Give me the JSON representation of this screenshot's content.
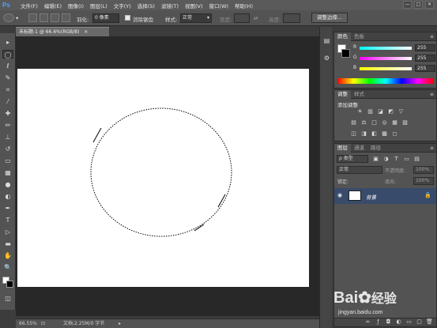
{
  "app": {
    "logo": "Ps"
  },
  "menu": [
    "文件(F)",
    "编辑(E)",
    "图像(I)",
    "图层(L)",
    "文字(Y)",
    "选择(S)",
    "滤镜(T)",
    "视图(V)",
    "窗口(W)",
    "帮助(H)"
  ],
  "window_controls": [
    "—",
    "□",
    "✕"
  ],
  "options": {
    "feather_label": "羽化:",
    "feather_value": "0 像素",
    "antialias_label": "消除锯齿",
    "style_label": "样式:",
    "style_value": "正常",
    "width_label": "宽度:",
    "height_label": "高度:",
    "refine_button": "调整边缘..."
  },
  "document": {
    "tab_title": "未标题-1 @ 66.6%(RGB/8)",
    "tab_close": "×"
  },
  "status": {
    "zoom": "66.55%",
    "doc_info": "文档:2.25M/0 字节"
  },
  "tools": [
    {
      "icon": "move-icon",
      "glyph": "▸"
    },
    {
      "icon": "ellipse-marquee-icon",
      "glyph": "◯"
    },
    {
      "icon": "lasso-icon",
      "glyph": "ℓ"
    },
    {
      "icon": "quick-select-icon",
      "glyph": "✎"
    },
    {
      "icon": "crop-icon",
      "glyph": "⌗"
    },
    {
      "icon": "eyedropper-icon",
      "glyph": "⁄"
    },
    {
      "icon": "healing-brush-icon",
      "glyph": "✚"
    },
    {
      "icon": "brush-icon",
      "glyph": "✏"
    },
    {
      "icon": "clone-stamp-icon",
      "glyph": "⊥"
    },
    {
      "icon": "history-brush-icon",
      "glyph": "↺"
    },
    {
      "icon": "eraser-icon",
      "glyph": "▭"
    },
    {
      "icon": "gradient-icon",
      "glyph": "▦"
    },
    {
      "icon": "blur-icon",
      "glyph": "●"
    },
    {
      "icon": "dodge-icon",
      "glyph": "◐"
    },
    {
      "icon": "pen-icon",
      "glyph": "✒"
    },
    {
      "icon": "type-icon",
      "glyph": "T"
    },
    {
      "icon": "path-select-icon",
      "glyph": "▷"
    },
    {
      "icon": "shape-icon",
      "glyph": "▬"
    },
    {
      "icon": "hand-icon",
      "glyph": "✋"
    },
    {
      "icon": "zoom-icon",
      "glyph": "🔍"
    }
  ],
  "color_panel": {
    "tabs": [
      "颜色",
      "色板"
    ],
    "channels": [
      {
        "label": "R",
        "value": "255",
        "color": "#e04848"
      },
      {
        "label": "G",
        "value": "255",
        "color": "#48d048"
      },
      {
        "label": "B",
        "value": "255",
        "color": "#4878e0"
      }
    ],
    "foreground": "#ffffff",
    "background": "#000000"
  },
  "adjustments_panel": {
    "tabs": [
      "调整",
      "样式"
    ],
    "title": "添加调整",
    "row1": [
      "☀",
      "▥",
      "◪",
      "◩",
      "▽"
    ],
    "row2": [
      "▤",
      "⚖",
      "□",
      "◎",
      "▦",
      "▧"
    ],
    "row3": [
      "◫",
      "◨",
      "◧",
      "▩",
      "◻"
    ]
  },
  "layers_panel": {
    "tabs": [
      "图层",
      "通道",
      "路径"
    ],
    "filter_label": "ρ 类型",
    "blend_mode": "正常",
    "opacity_label": "不透明度:",
    "opacity_value": "100%",
    "lock_label": "锁定:",
    "fill_label": "填充:",
    "fill_value": "100%",
    "layer_name": "背景"
  },
  "watermark": {
    "brand": "Bai",
    "brand2": "经验",
    "url": "jingyan.baidu.com"
  }
}
